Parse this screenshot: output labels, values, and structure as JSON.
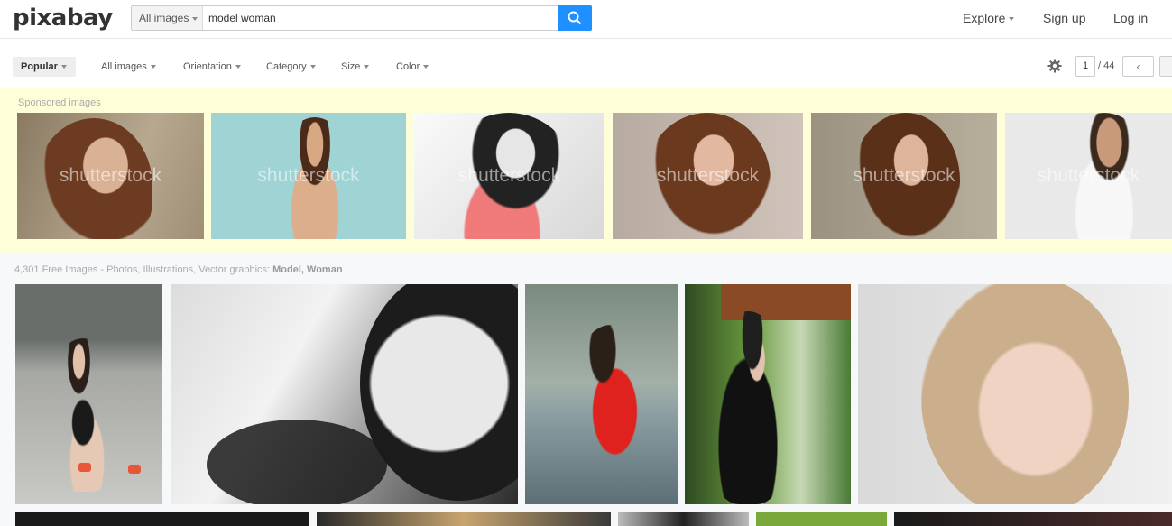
{
  "header": {
    "logo": "pixabay",
    "search_type": "All images",
    "search_value": "model woman",
    "nav": {
      "explore": "Explore",
      "signup": "Sign up",
      "login": "Log in"
    }
  },
  "toolbar": {
    "filters": {
      "popular": "Popular",
      "all_images": "All images",
      "orientation": "Orientation",
      "category": "Category",
      "size": "Size",
      "color": "Color"
    },
    "page": {
      "current": "1",
      "total": "/ 44",
      "prev": "‹"
    }
  },
  "sponsored": {
    "label": "Sponsored images",
    "watermark": "shutterstock"
  },
  "results": {
    "label_prefix": "4,301 Free Images - Photos, Illustrations, Vector graphics: ",
    "label_terms": "Model, Woman"
  },
  "colors": {
    "search_button": "#1e90ff",
    "sponsored_bg": "#fefed8"
  }
}
